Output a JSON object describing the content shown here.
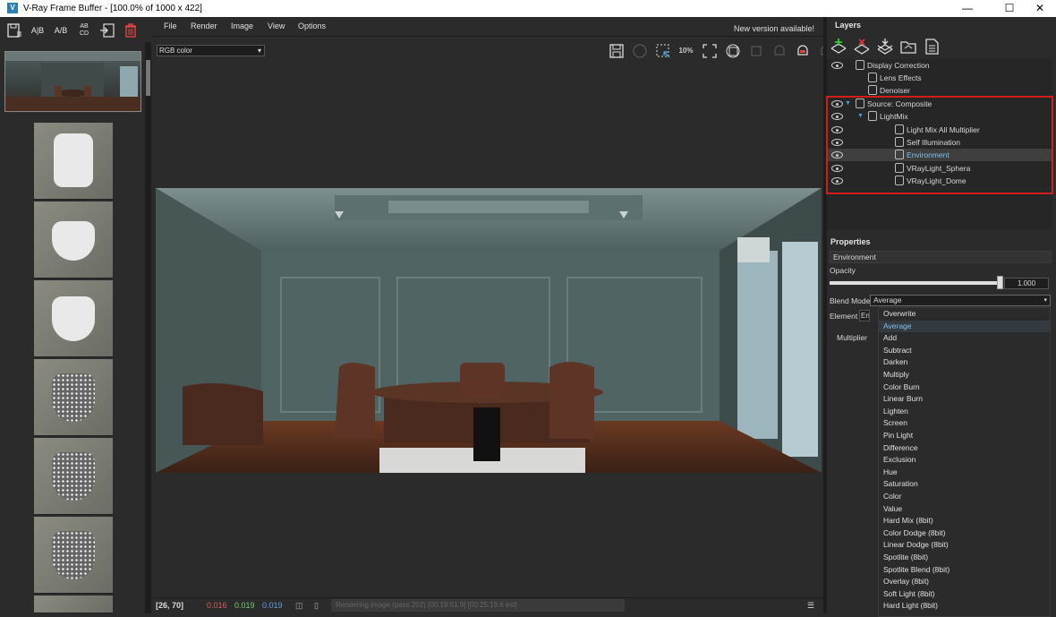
{
  "window": {
    "title": "V-Ray Frame Buffer - [100.0% of 1000 x 422]"
  },
  "left_toolbar": {
    "icons": [
      "save-history-icon",
      "ab-compare-horizontal-icon",
      "ab-compare-diagonal-icon",
      "abcd-compare-icon",
      "import-icon",
      "delete-icon"
    ],
    "ab": "A|B",
    "ab2": "A/B",
    "abcd": "AB\nCD"
  },
  "menu": {
    "items": [
      "File",
      "Render",
      "Image",
      "View",
      "Options"
    ],
    "new_version": "New version available!"
  },
  "channel": {
    "value": "RGB color"
  },
  "render_toolbar": {
    "zoom_label": "10%"
  },
  "status": {
    "coords": "[26, 70]",
    "r": "0.016",
    "g": "0.019",
    "b": "0.019",
    "progress": "Rendering image (pass 202) [00:19:51.9] [00:25:19.6 est]",
    "colors": {
      "r": "#e05a5a",
      "g": "#6fd46f",
      "b": "#5fa0ea"
    }
  },
  "layers": {
    "header": "Layers",
    "items": [
      {
        "label": "Display Correction",
        "level": 1,
        "eye": true,
        "icon": "curve-icon"
      },
      {
        "label": "Lens Effects",
        "level": 2,
        "eye": false,
        "icon": "lens-effects-icon"
      },
      {
        "label": "Denoiser",
        "level": 2,
        "eye": false,
        "icon": "denoiser-icon"
      },
      {
        "label": "Source: Composite",
        "level": 1,
        "eye": true,
        "icon": "composite-icon",
        "expand": true
      },
      {
        "label": "LightMix",
        "level": 2,
        "eye": true,
        "icon": "folder-icon",
        "expand": true
      },
      {
        "label": "Light Mix All Multiplier",
        "level": 3,
        "eye": true,
        "icon": "multiplier-icon"
      },
      {
        "label": "Self Illumination",
        "level": 3,
        "eye": true,
        "icon": "layer-stack-icon"
      },
      {
        "label": "Environment",
        "level": 3,
        "eye": true,
        "icon": "layer-stack-icon",
        "selected": true
      },
      {
        "label": "VRayLight_Sphera",
        "level": 3,
        "eye": true,
        "icon": "layer-stack-icon"
      },
      {
        "label": "VRayLight_Dome",
        "level": 3,
        "eye": true,
        "icon": "layer-stack-icon"
      }
    ]
  },
  "properties": {
    "header": "Properties",
    "name": "Environment",
    "opacity_label": "Opacity",
    "opacity_value": "1.000",
    "opacity_fraction": 1.0,
    "blend_label": "Blend Mode",
    "blend_value": "Average",
    "element_label": "Element",
    "element_value": "En",
    "multiplier_label": "Multiplier",
    "blend_options": [
      "Overwrite",
      "Average",
      "Add",
      "Subtract",
      "Darken",
      "Multiply",
      "Color Burn",
      "Linear Burn",
      "Lighten",
      "Screen",
      "Pin Light",
      "Difference",
      "Exclusion",
      "Hue",
      "Saturation",
      "Color",
      "Value",
      "Hard Mix (8bit)",
      "Color Dodge (8bit)",
      "Linear Dodge (8bit)",
      "Spotlite (8bit)",
      "Spotlite Blend (8bit)",
      "Overlay (8bit)",
      "Soft Light (8bit)",
      "Hard Light (8bit)"
    ]
  },
  "highlight_color": "#d11d1d"
}
